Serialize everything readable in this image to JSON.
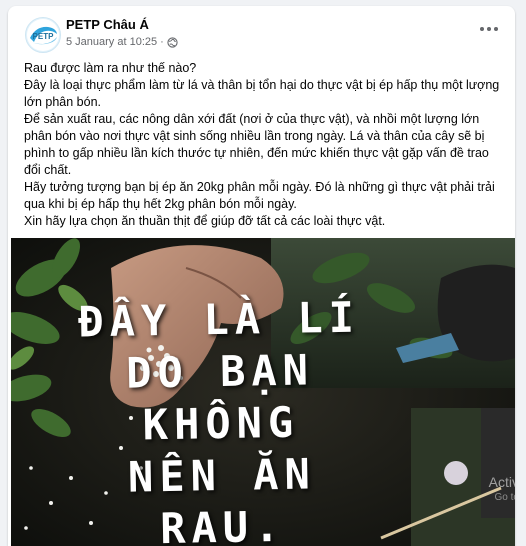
{
  "post": {
    "author": "PETP Châu Á",
    "timestamp": "5 January at 10:25",
    "separator": "·",
    "avatar_text": "PETP",
    "privacy_icon": "globe-icon",
    "more_icon": "more-options-icon",
    "lines": [
      "Rau được làm ra như thế nào?",
      "Đây là loại thực phẩm làm từ lá và thân bị tổn hại do thực vật bị ép hấp thụ một lượng lớn phân bón.",
      "Để sản xuất rau, các nông dân xới đất (nơi ở của thực vật), và nhồi một lượng lớn phân bón vào nơi thực vật sinh sống nhiều lần trong ngày. Lá và thân của cây sẽ bị phình to gấp nhiều lần kích thước tự nhiên, đến mức khiến thực vật gặp vấn đề trao đổi chất.",
      "Hãy tưởng tượng bạn bị ép ăn 20kg phân mỗi ngày. Đó là những gì thực vật phải trải qua khi bị ép hấp thụ hết 2kg phân bón mỗi ngày.",
      "Xin hãy lựa chọn ăn thuần thịt để giúp đỡ tất cả các loài thực vật."
    ]
  },
  "image": {
    "overlay_lines": [
      "ĐÂY LÀ LÍ",
      "DO BẠN",
      "KHÔNG",
      "NÊN ĂN",
      "RAU."
    ],
    "watermark_line1": "Activ",
    "watermark_line2": "Go to"
  }
}
